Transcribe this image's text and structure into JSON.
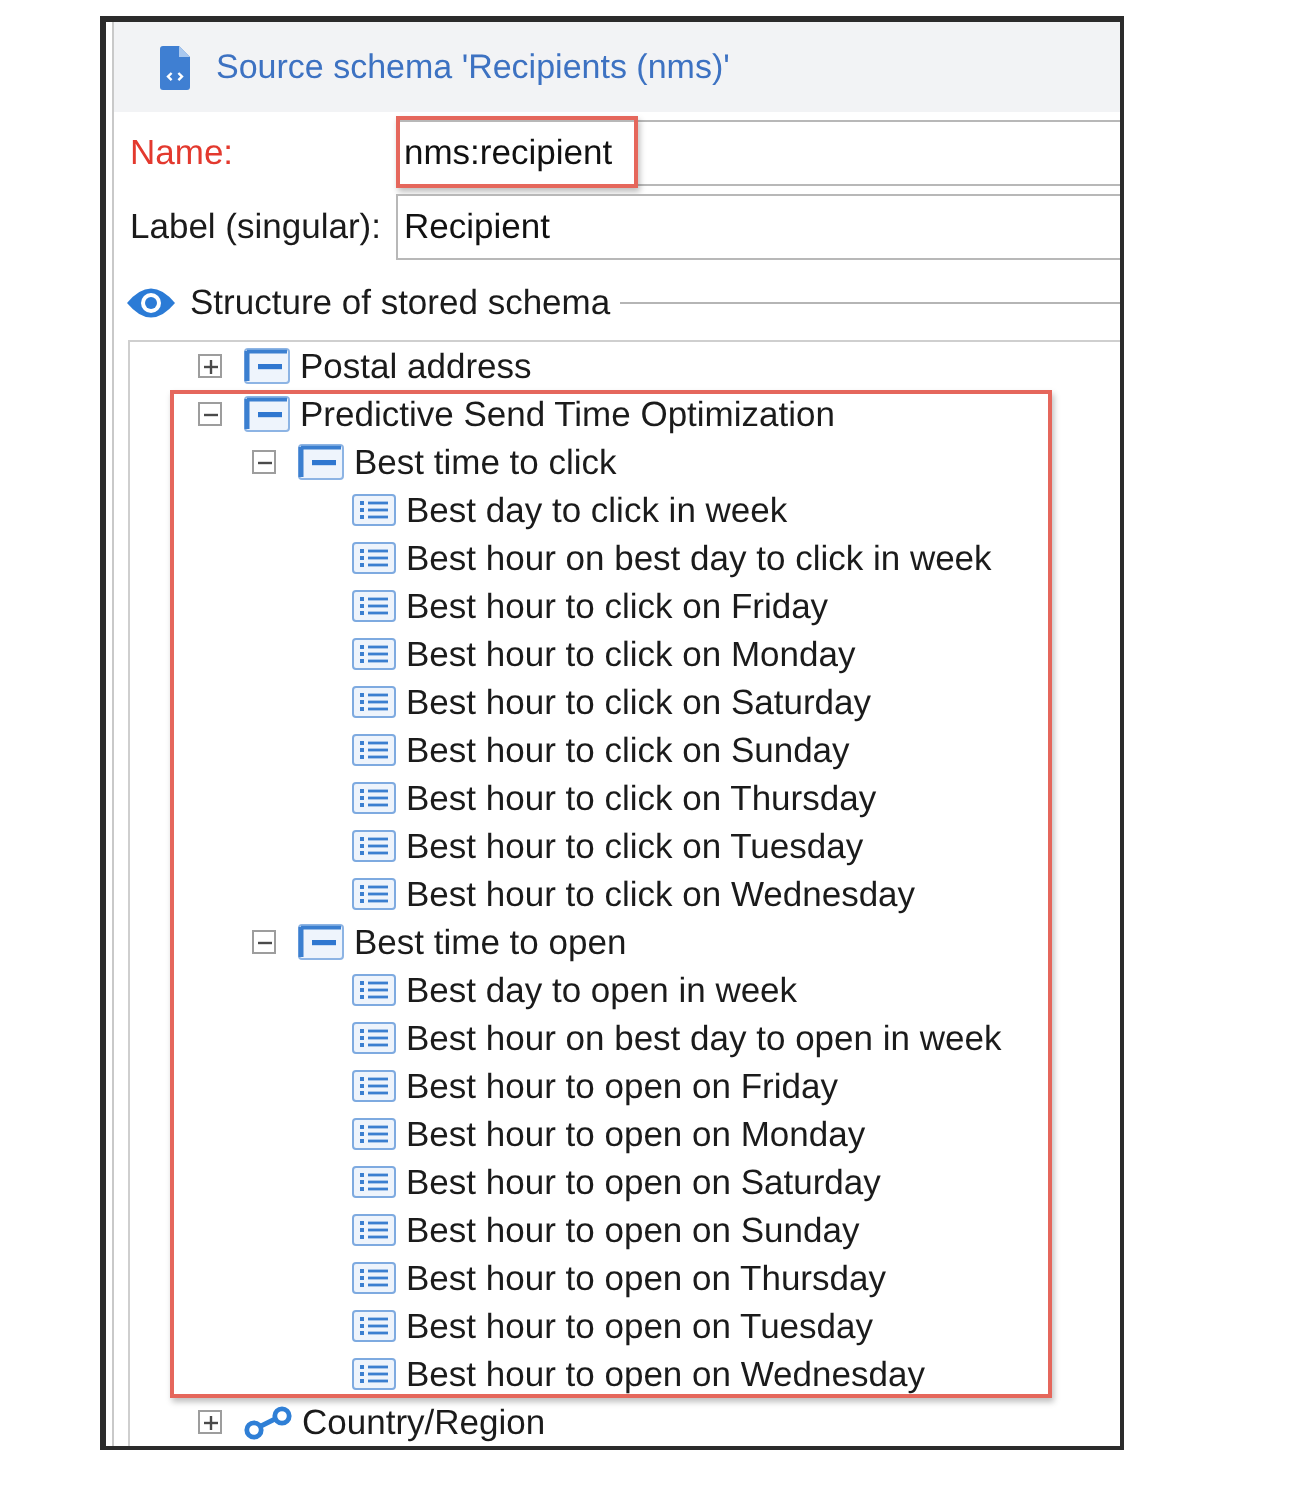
{
  "header": {
    "title": "Source schema 'Recipients (nms)'"
  },
  "fields": [
    {
      "label": "Name:",
      "value": "nms:recipient",
      "required": true,
      "highlighted": true
    },
    {
      "label": "Label (singular):",
      "value": "Recipient",
      "required": false,
      "highlighted": false
    }
  ],
  "structure": {
    "title": "Structure of stored schema",
    "tree": [
      {
        "label": "Postal address",
        "kind": "element",
        "expanded": false,
        "highlighted": false
      },
      {
        "label": "Predictive Send Time Optimization",
        "kind": "element",
        "expanded": true,
        "highlighted": true,
        "children": [
          {
            "label": "Best time to click",
            "kind": "element",
            "expanded": true,
            "children": [
              {
                "label": "Best day to click in week",
                "kind": "attribute"
              },
              {
                "label": "Best hour on best day to click in week",
                "kind": "attribute"
              },
              {
                "label": "Best hour to click on Friday",
                "kind": "attribute"
              },
              {
                "label": "Best hour to click on Monday",
                "kind": "attribute"
              },
              {
                "label": "Best hour to click on Saturday",
                "kind": "attribute"
              },
              {
                "label": "Best hour to click on Sunday",
                "kind": "attribute"
              },
              {
                "label": "Best hour to click on Thursday",
                "kind": "attribute"
              },
              {
                "label": "Best hour to click on Tuesday",
                "kind": "attribute"
              },
              {
                "label": "Best hour to click on Wednesday",
                "kind": "attribute"
              }
            ]
          },
          {
            "label": "Best time to open",
            "kind": "element",
            "expanded": true,
            "children": [
              {
                "label": "Best day to open in week",
                "kind": "attribute"
              },
              {
                "label": "Best hour on best day to open in week",
                "kind": "attribute"
              },
              {
                "label": "Best hour to open on Friday",
                "kind": "attribute"
              },
              {
                "label": "Best hour to open on Monday",
                "kind": "attribute"
              },
              {
                "label": "Best hour to open on Saturday",
                "kind": "attribute"
              },
              {
                "label": "Best hour to open on Sunday",
                "kind": "attribute"
              },
              {
                "label": "Best hour to open on Thursday",
                "kind": "attribute"
              },
              {
                "label": "Best hour to open on Tuesday",
                "kind": "attribute"
              },
              {
                "label": "Best hour to open on Wednesday",
                "kind": "attribute"
              }
            ]
          }
        ]
      },
      {
        "label": "Country/Region",
        "kind": "link",
        "expanded": false,
        "highlighted": false
      }
    ]
  }
}
